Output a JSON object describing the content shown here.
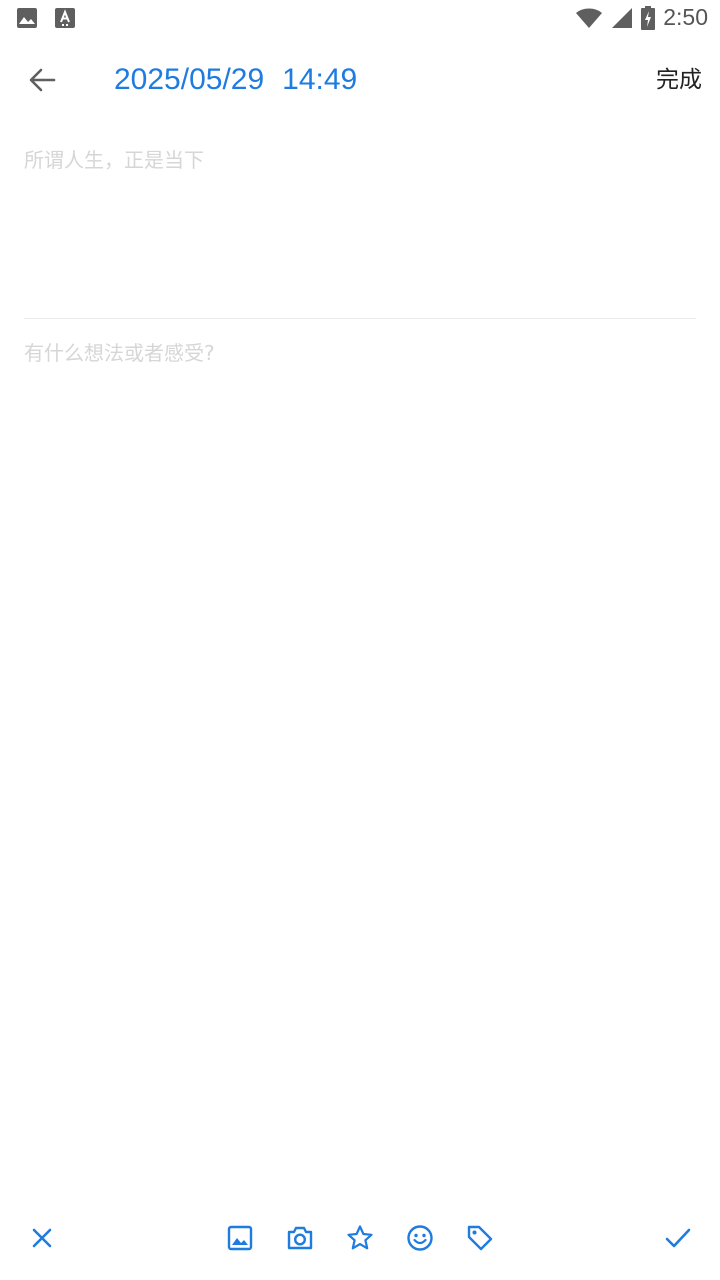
{
  "status_bar": {
    "time": "2:50",
    "icons": [
      "image-icon",
      "text-a-icon",
      "wifi-icon",
      "signal-icon",
      "battery-charging-icon"
    ]
  },
  "header": {
    "date": "2025/05/29",
    "time": "14:49",
    "done_label": "完成"
  },
  "editor": {
    "title_placeholder": "所谓人生，正是当下",
    "content_placeholder": "有什么想法或者感受?"
  },
  "toolbar": {
    "items": [
      "close-icon",
      "image-icon",
      "camera-icon",
      "star-icon",
      "emoji-icon",
      "tag-icon",
      "check-icon"
    ]
  },
  "colors": {
    "accent": "#1e7be0",
    "placeholder": "#d6d6d6",
    "divider": "#ececec"
  }
}
